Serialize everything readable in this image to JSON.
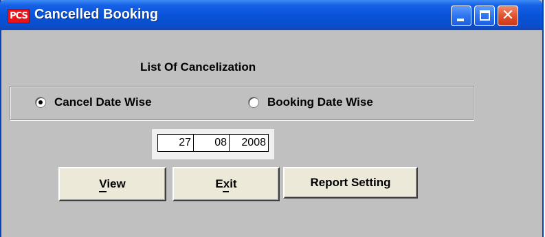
{
  "window": {
    "app_icon_text": "PCS",
    "title": "Cancelled Booking",
    "controls": {
      "minimize_icon": "minimize-icon",
      "maximize_icon": "maximize-icon",
      "close_icon": "close-icon"
    }
  },
  "form": {
    "heading": "List Of Cancelization",
    "options": [
      {
        "label": "Cancel Date Wise",
        "selected": true
      },
      {
        "label": "Booking Date Wise",
        "selected": false
      }
    ],
    "date": {
      "day": "27",
      "month": "08",
      "year": "2008"
    },
    "buttons": {
      "view": "View",
      "exit": "Exit",
      "report_setting": "Report Setting"
    }
  },
  "colors": {
    "titlebar": "#0752d6",
    "window_bg": "#c0c0c0",
    "button_bg": "#ece9d8",
    "close_button": "#e3522e"
  }
}
